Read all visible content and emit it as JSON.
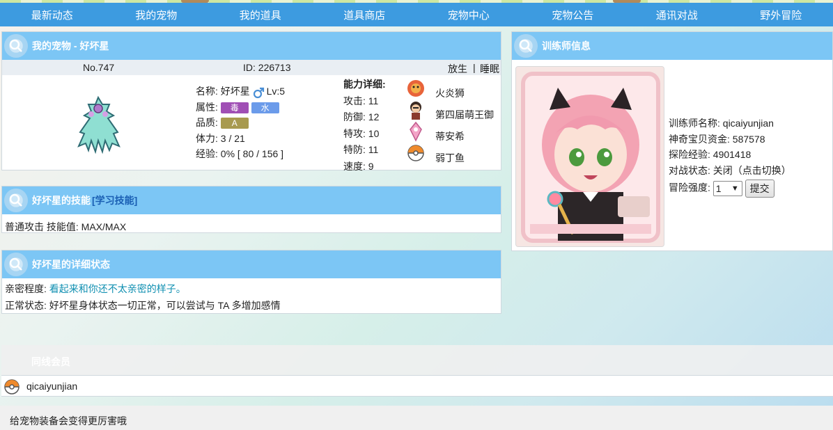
{
  "nav": [
    {
      "label": "最新动态"
    },
    {
      "label": "我的宠物"
    },
    {
      "label": "我的道具"
    },
    {
      "label": "道具商店"
    },
    {
      "label": "宠物中心"
    },
    {
      "label": "宠物公告"
    },
    {
      "label": "通讯对战"
    },
    {
      "label": "野外冒险"
    }
  ],
  "pet_panel": {
    "title": "我的宠物 - 好坏星",
    "number": "No.747",
    "id": "ID: 226713",
    "release": "放生",
    "separator": "|",
    "sleep": "睡眠",
    "name_label": "名称:",
    "name": "好坏星",
    "level": "Lv:5",
    "attr_label": "属性:",
    "type1": "毒",
    "type2": "水",
    "quality_label": "品质:",
    "quality": "A",
    "hp_label": "体力:",
    "hp": "3 / 21",
    "exp_label": "经验:",
    "exp": "0% [ 80 / 156 ]",
    "ability_title": "能力详细:",
    "attack": "攻击: 11",
    "defense": "防御: 12",
    "sp_attack": "特攻: 10",
    "sp_defense": "特防: 11",
    "speed": "速度: 9",
    "monsters": [
      {
        "name": "火炎狮"
      },
      {
        "name": "第四届萌王御"
      },
      {
        "name": "蒂安希"
      },
      {
        "name": "弱丁鱼"
      }
    ]
  },
  "skill_panel": {
    "title_prefix": "好坏星的技能",
    "learn_link": "[学习技能]",
    "content": "普通攻击 技能值: MAX/MAX"
  },
  "status_panel": {
    "title": "好坏星的详细状态",
    "intimacy_label": "亲密程度:",
    "intimacy_value": "看起来和你还不太亲密的样子。",
    "normal_status": "正常状态: 好坏星身体状态一切正常，可以尝试与 TA 多增加感情"
  },
  "trainer_panel": {
    "title": "训练师信息",
    "name": "训练师名称: qicaiyunjian",
    "money": "神奇宝贝资金: 587578",
    "explore_exp": "探险经验: 4901418",
    "battle_state_label": "对战状态: ",
    "battle_state": "关闭（点击切换）",
    "intensity_label": "冒险强度:",
    "intensity_value": "1",
    "submit": "提交"
  },
  "online": {
    "title": "同线会员",
    "members": [
      "qicaiyunjian"
    ]
  },
  "footer_tip": "给宠物装备会变得更厉害哦",
  "colors": {
    "nav": "#3d9be0",
    "panel_head": "#7cc6f5",
    "poison": "#a04fb5",
    "water": "#6b9bea",
    "quality_a": "#a89a4f"
  }
}
